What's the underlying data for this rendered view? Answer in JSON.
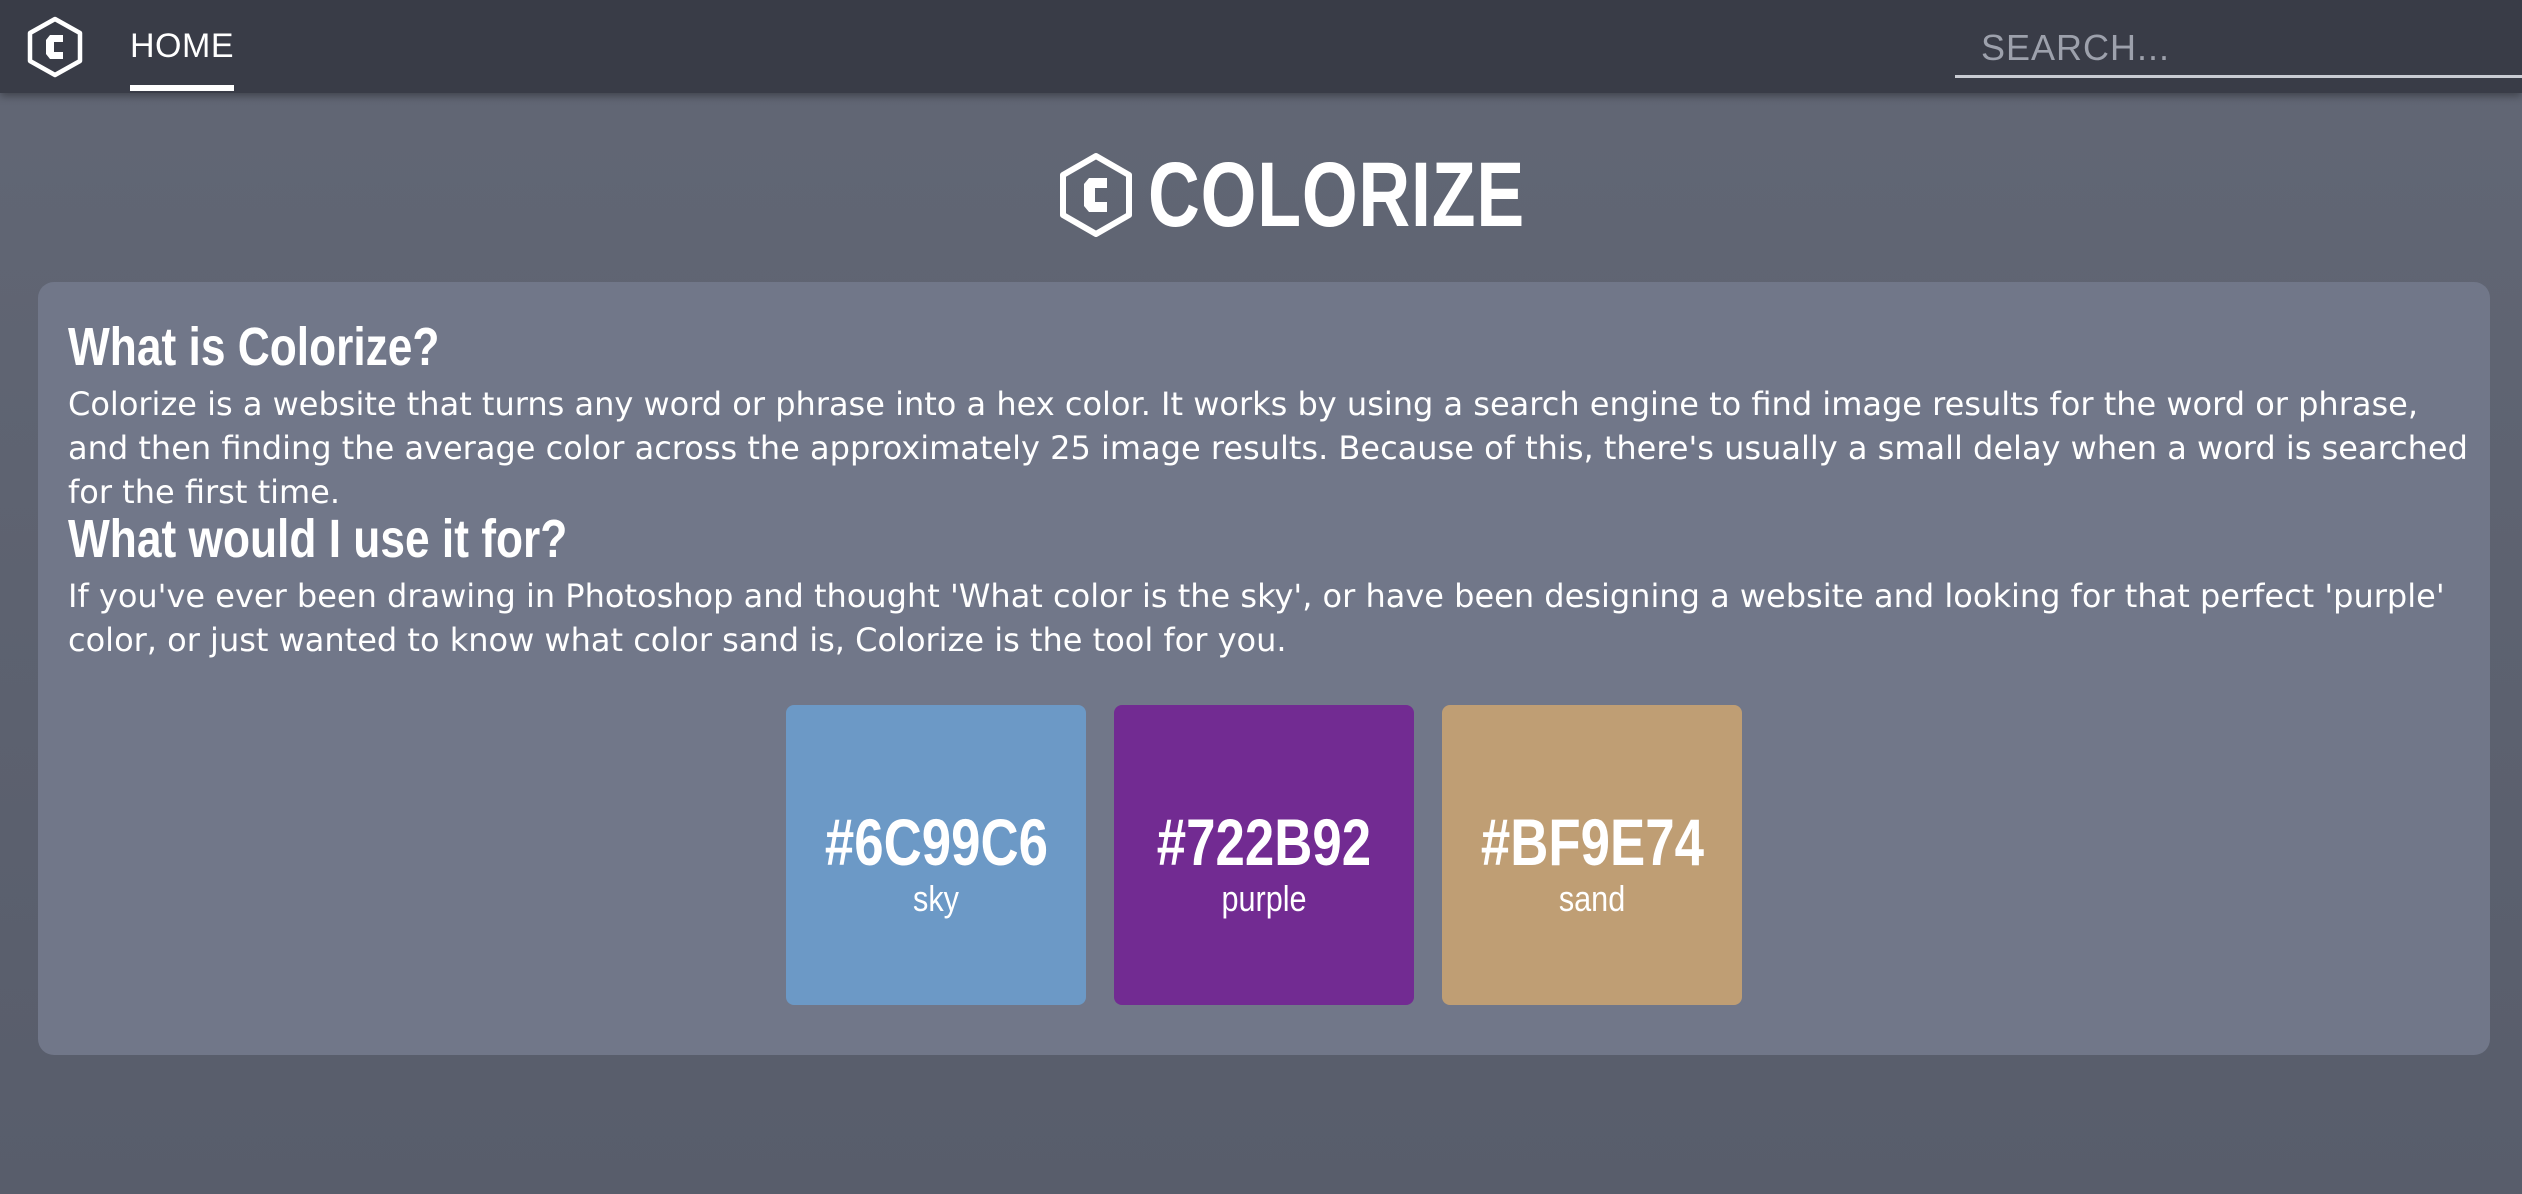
{
  "nav": {
    "home_label": "HOME",
    "search_placeholder": "SEARCH..."
  },
  "brand": {
    "title": "COLORIZE",
    "logo_icon": "hexagon-c-logo-icon"
  },
  "sections": [
    {
      "heading": "What is Colorize?",
      "body": "Colorize is a website that turns any word or phrase into a hex color. It works by using a search engine to find image results for the word or phrase, and then finding the average color across the approximately 25 image results. Because of this, there's usually a small delay when a word is searched for the first time."
    },
    {
      "heading": "What would I use it for?",
      "body": "If you've ever been drawing in Photoshop and thought 'What color is the sky', or have been designing a website and looking for that perfect 'purple' color, or just wanted to know what color sand is, Colorize is the tool for you."
    }
  ],
  "swatches": [
    {
      "hex": "#6C99C6",
      "word": "sky",
      "color": "#6C99C6"
    },
    {
      "hex": "#722B92",
      "word": "purple",
      "color": "#722B92"
    },
    {
      "hex": "#BF9E74",
      "word": "sand",
      "color": "#BF9E74"
    }
  ],
  "colors": {
    "navbar": "#393c47",
    "background": "#5d6270",
    "card": "#717789",
    "text": "#ffffff"
  }
}
